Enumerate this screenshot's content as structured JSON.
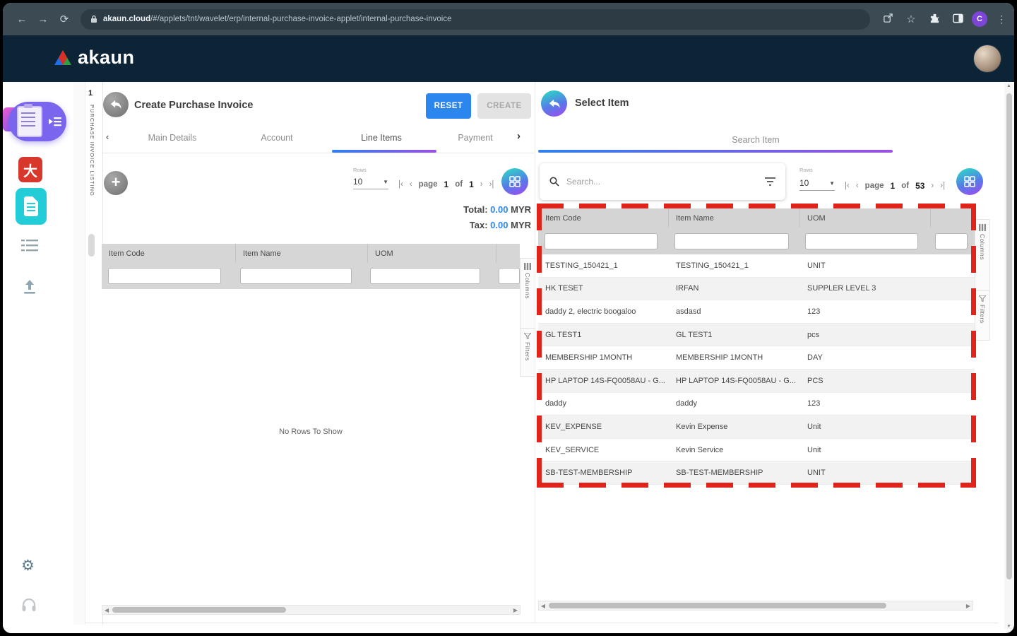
{
  "browser": {
    "url_domain": "akaun.cloud",
    "url_path": "/#/applets/tnt/wavelet/erp/internal-purchase-invoice-applet/internal-purchase-invoice",
    "profile_initial": "C"
  },
  "header": {
    "brand": "akaun"
  },
  "collapsed_panel": {
    "index": "1",
    "label": "PURCHASE INVOICE LISTING"
  },
  "left_panel": {
    "title": "Create Purchase Invoice",
    "reset_label": "RESET",
    "create_label": "CREATE",
    "tabs": [
      {
        "label": "Main Details"
      },
      {
        "label": "Account"
      },
      {
        "label": "Line Items"
      },
      {
        "label": "Payment"
      }
    ],
    "rows_label": "Rows",
    "rows_value": "10",
    "pagination": {
      "page_word": "page",
      "current": "1",
      "of_word": "of",
      "total": "1"
    },
    "totals": {
      "total_label": "Total:",
      "total_value": "0.00",
      "tax_label": "Tax:",
      "tax_value": "0.00",
      "currency": "MYR"
    },
    "table": {
      "headers": [
        "Item Code",
        "Item Name",
        "UOM"
      ],
      "empty_text": "No Rows To Show"
    },
    "side_tabs": {
      "columns": "Columns",
      "filters": "Filters"
    }
  },
  "right_panel": {
    "title": "Select Item",
    "tab_label": "Search Item",
    "search_placeholder": "Search...",
    "rows_label": "Rows",
    "rows_value": "10",
    "pagination": {
      "page_word": "page",
      "current": "1",
      "of_word": "of",
      "total": "53"
    },
    "table": {
      "headers": [
        "Item Code",
        "Item Name",
        "UOM"
      ],
      "rows": [
        {
          "code": "TESTING_150421_1",
          "name": "TESTING_150421_1",
          "uom": "UNIT"
        },
        {
          "code": "HK TESET",
          "name": "IRFAN",
          "uom": "SUPPLER LEVEL 3"
        },
        {
          "code": "daddy 2, electric boogaloo",
          "name": "asdasd",
          "uom": "123"
        },
        {
          "code": "GL TEST1",
          "name": "GL TEST1",
          "uom": "pcs"
        },
        {
          "code": "MEMBERSHIP 1MONTH",
          "name": "MEMBERSHIP 1MONTH",
          "uom": "DAY"
        },
        {
          "code": "HP LAPTOP 14S-FQ0058AU - G...",
          "name": "HP LAPTOP 14S-FQ0058AU - G...",
          "uom": "PCS"
        },
        {
          "code": "daddy",
          "name": "daddy",
          "uom": "123"
        },
        {
          "code": "KEV_EXPENSE",
          "name": "Kevin Expense",
          "uom": "Unit"
        },
        {
          "code": "KEV_SERVICE",
          "name": "Kevin Service",
          "uom": "Unit"
        },
        {
          "code": "SB-TEST-MEMBERSHIP",
          "name": "SB-TEST-MEMBERSHIP",
          "uom": "UNIT"
        }
      ]
    },
    "side_tabs": {
      "columns": "Columns",
      "filters": "Filters"
    }
  },
  "icons": {
    "back": "back-arrow",
    "forward": "forward-arrow",
    "reload": "reload",
    "lock": "padlock",
    "share": "share",
    "bookmark": "star",
    "extensions": "puzzle",
    "sidepanel": "side-panel",
    "menu": "kebab-menu",
    "search": "magnifier",
    "filter": "filter-lines",
    "grid": "grid-view",
    "add": "plus",
    "settings": "gear",
    "support": "headset",
    "upload": "upload"
  },
  "colors": {
    "accent_blue": "#2b86ee",
    "purple": "#7b5cf0",
    "teal": "#23cdd8",
    "navy_header": "#0d2336",
    "annotation_red": "#e0241c",
    "table_header_gray": "#d6d6d6"
  }
}
